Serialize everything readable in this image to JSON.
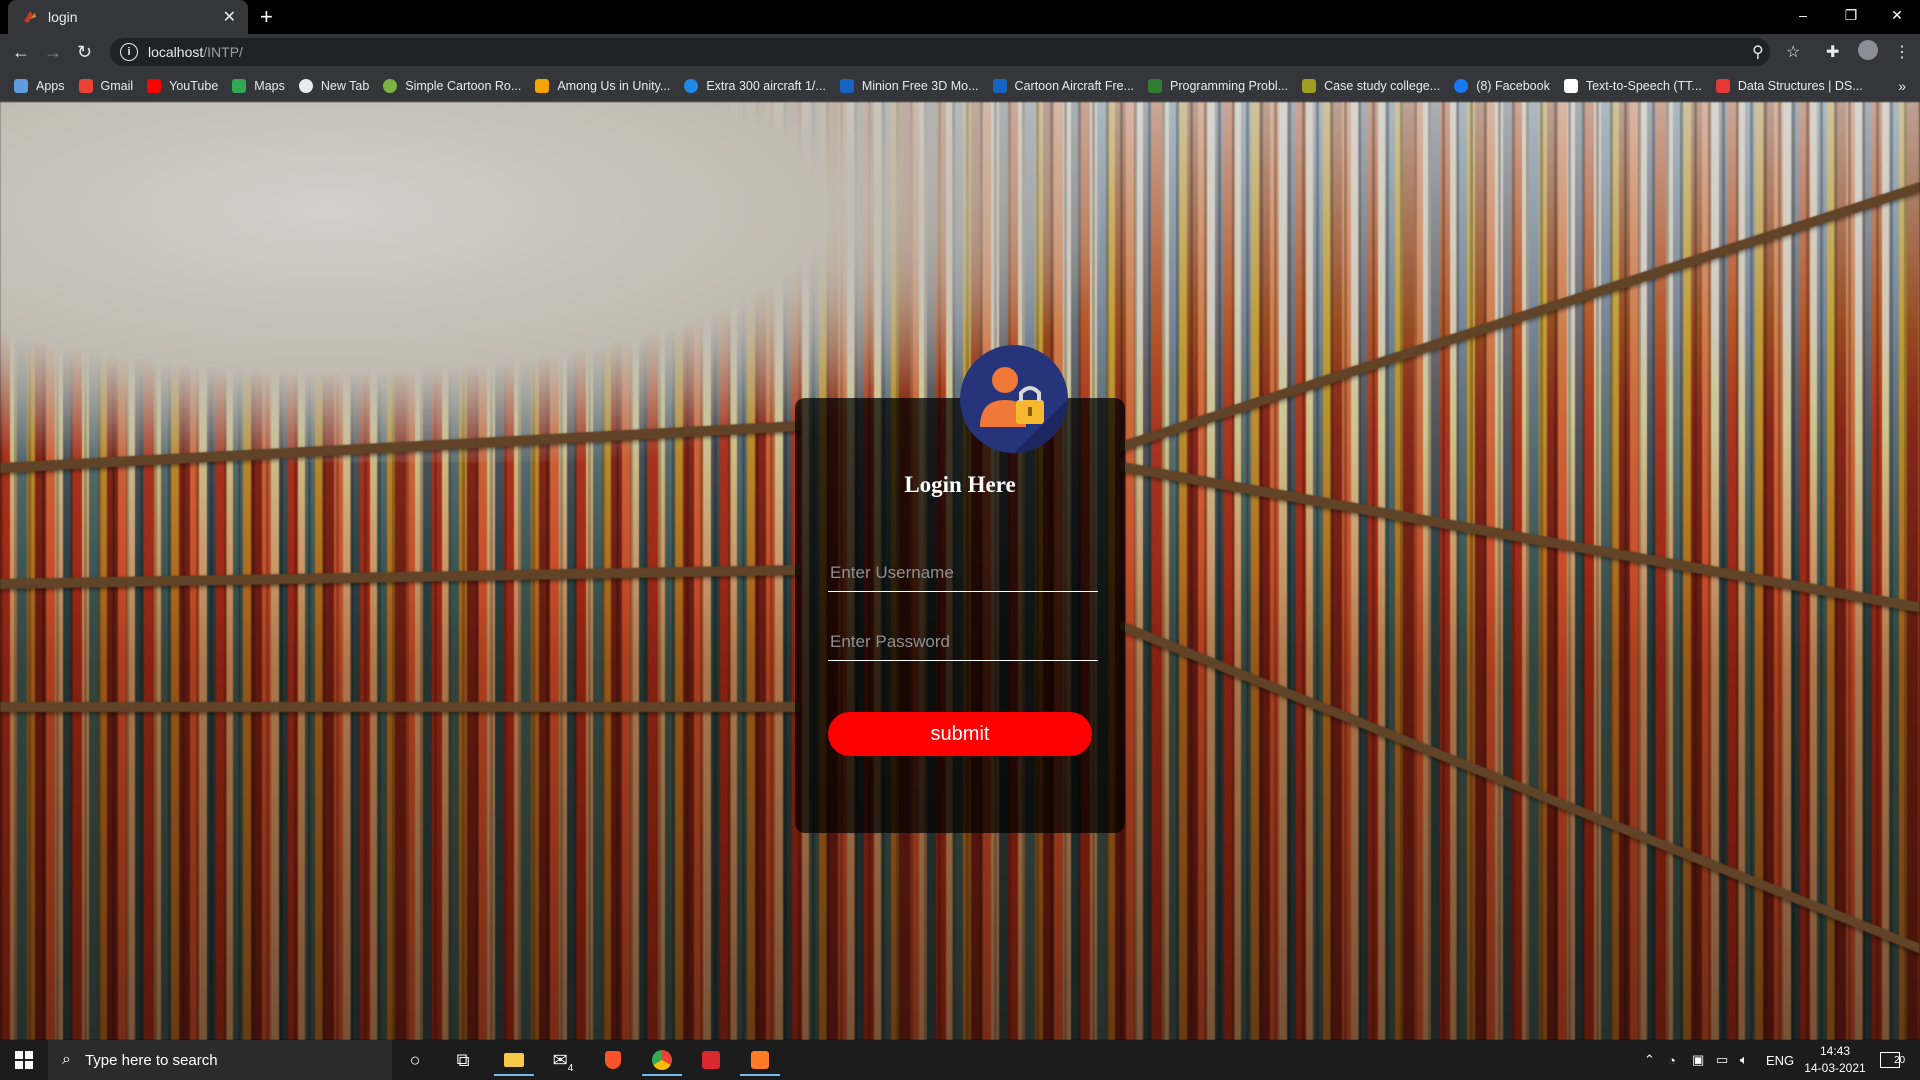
{
  "browser": {
    "tab_title": "login",
    "url_host": "localhost",
    "url_path": "/INTP/",
    "bookmarks": [
      {
        "label": "Apps",
        "color": "#5f9ddf"
      },
      {
        "label": "Gmail",
        "color": "#ea4335"
      },
      {
        "label": "YouTube",
        "color": "#ff0000"
      },
      {
        "label": "Maps",
        "color": "#34a853"
      },
      {
        "label": "New Tab",
        "color": "#e8eaed"
      },
      {
        "label": "Simple Cartoon Ro...",
        "color": "#7cb342"
      },
      {
        "label": "Among Us in Unity...",
        "color": "#f4a300"
      },
      {
        "label": "Extra 300 aircraft 1/...",
        "color": "#1e88e5"
      },
      {
        "label": "Minion Free 3D Mo...",
        "color": "#1565c0"
      },
      {
        "label": "Cartoon Aircraft Fre...",
        "color": "#1565c0"
      },
      {
        "label": "Programming Probl...",
        "color": "#2e7d32"
      },
      {
        "label": "Case study college...",
        "color": "#9e9d24"
      },
      {
        "label": "(8) Facebook",
        "color": "#1877f2"
      },
      {
        "label": "Text-to-Speech (TT...",
        "color": "#ffffff"
      },
      {
        "label": "Data Structures | DS...",
        "color": "#e53935"
      }
    ]
  },
  "login": {
    "title": "Login Here",
    "username_placeholder": "Enter Username",
    "password_placeholder": "Enter Password",
    "submit_label": "submit",
    "button_color": "#ff0000",
    "avatar_color": "#26357b"
  },
  "taskbar": {
    "search_placeholder": "Type here to search",
    "mail_badge": "4",
    "language": "ENG",
    "time": "14:43",
    "date": "14-03-2021",
    "notification_count": "20"
  }
}
